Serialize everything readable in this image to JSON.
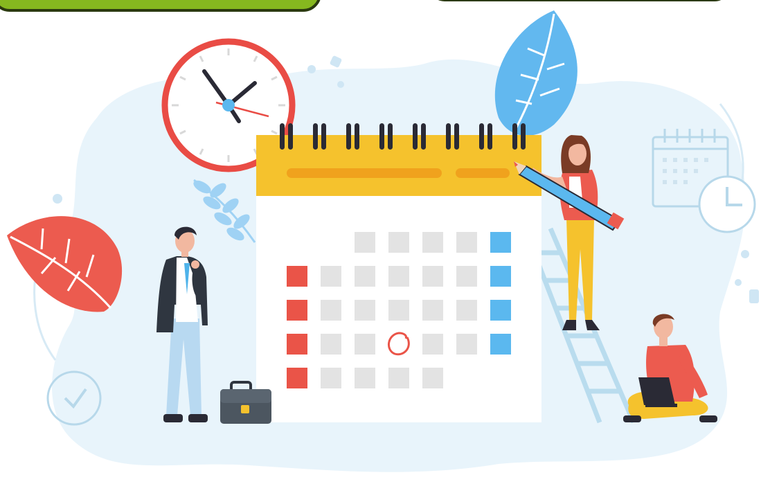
{
  "colors": {
    "background": "#ffffff",
    "blob": "#e8f4fb",
    "blob_line": "#d7eaf5",
    "banner_green": "#86b81f",
    "banner_border": "#2b3a10",
    "calendar_header": "#f5c22d",
    "calendar_header_bar": "#f0a21d",
    "calendar_body": "#ffffff",
    "cell_gray": "#e3e3e3",
    "cell_red": "#ea5448",
    "cell_blue": "#5bb8ef",
    "ring_dark": "#2a2a35",
    "clock_rim": "#e94c45",
    "leaf_blue": "#62b8ef",
    "leaf_red": "#ec5b4f",
    "leaf_light_blue": "#9fd2f4",
    "ladder": "#b9dcee",
    "accent_outline": "#b7d8ea"
  },
  "icons": {
    "clock": "wall-clock-icon",
    "mini_calendar": "calendar-outline-icon",
    "mini_clock": "clock-outline-icon",
    "check": "check-circle-icon",
    "briefcase": "briefcase-icon",
    "pencil": "pencil-icon",
    "circle_mark": "circled-date-mark"
  },
  "calendar": {
    "rows": [
      [
        "empty",
        "empty",
        "gray",
        "gray",
        "gray",
        "gray",
        "blue"
      ],
      [
        "red",
        "gray",
        "gray",
        "gray",
        "gray",
        "gray",
        "blue"
      ],
      [
        "red",
        "gray",
        "gray",
        "gray",
        "gray",
        "gray",
        "blue"
      ],
      [
        "red",
        "gray",
        "gray",
        "marked",
        "gray",
        "gray",
        "blue"
      ],
      [
        "red",
        "gray",
        "gray",
        "gray",
        "gray",
        "empty",
        "empty"
      ]
    ]
  }
}
